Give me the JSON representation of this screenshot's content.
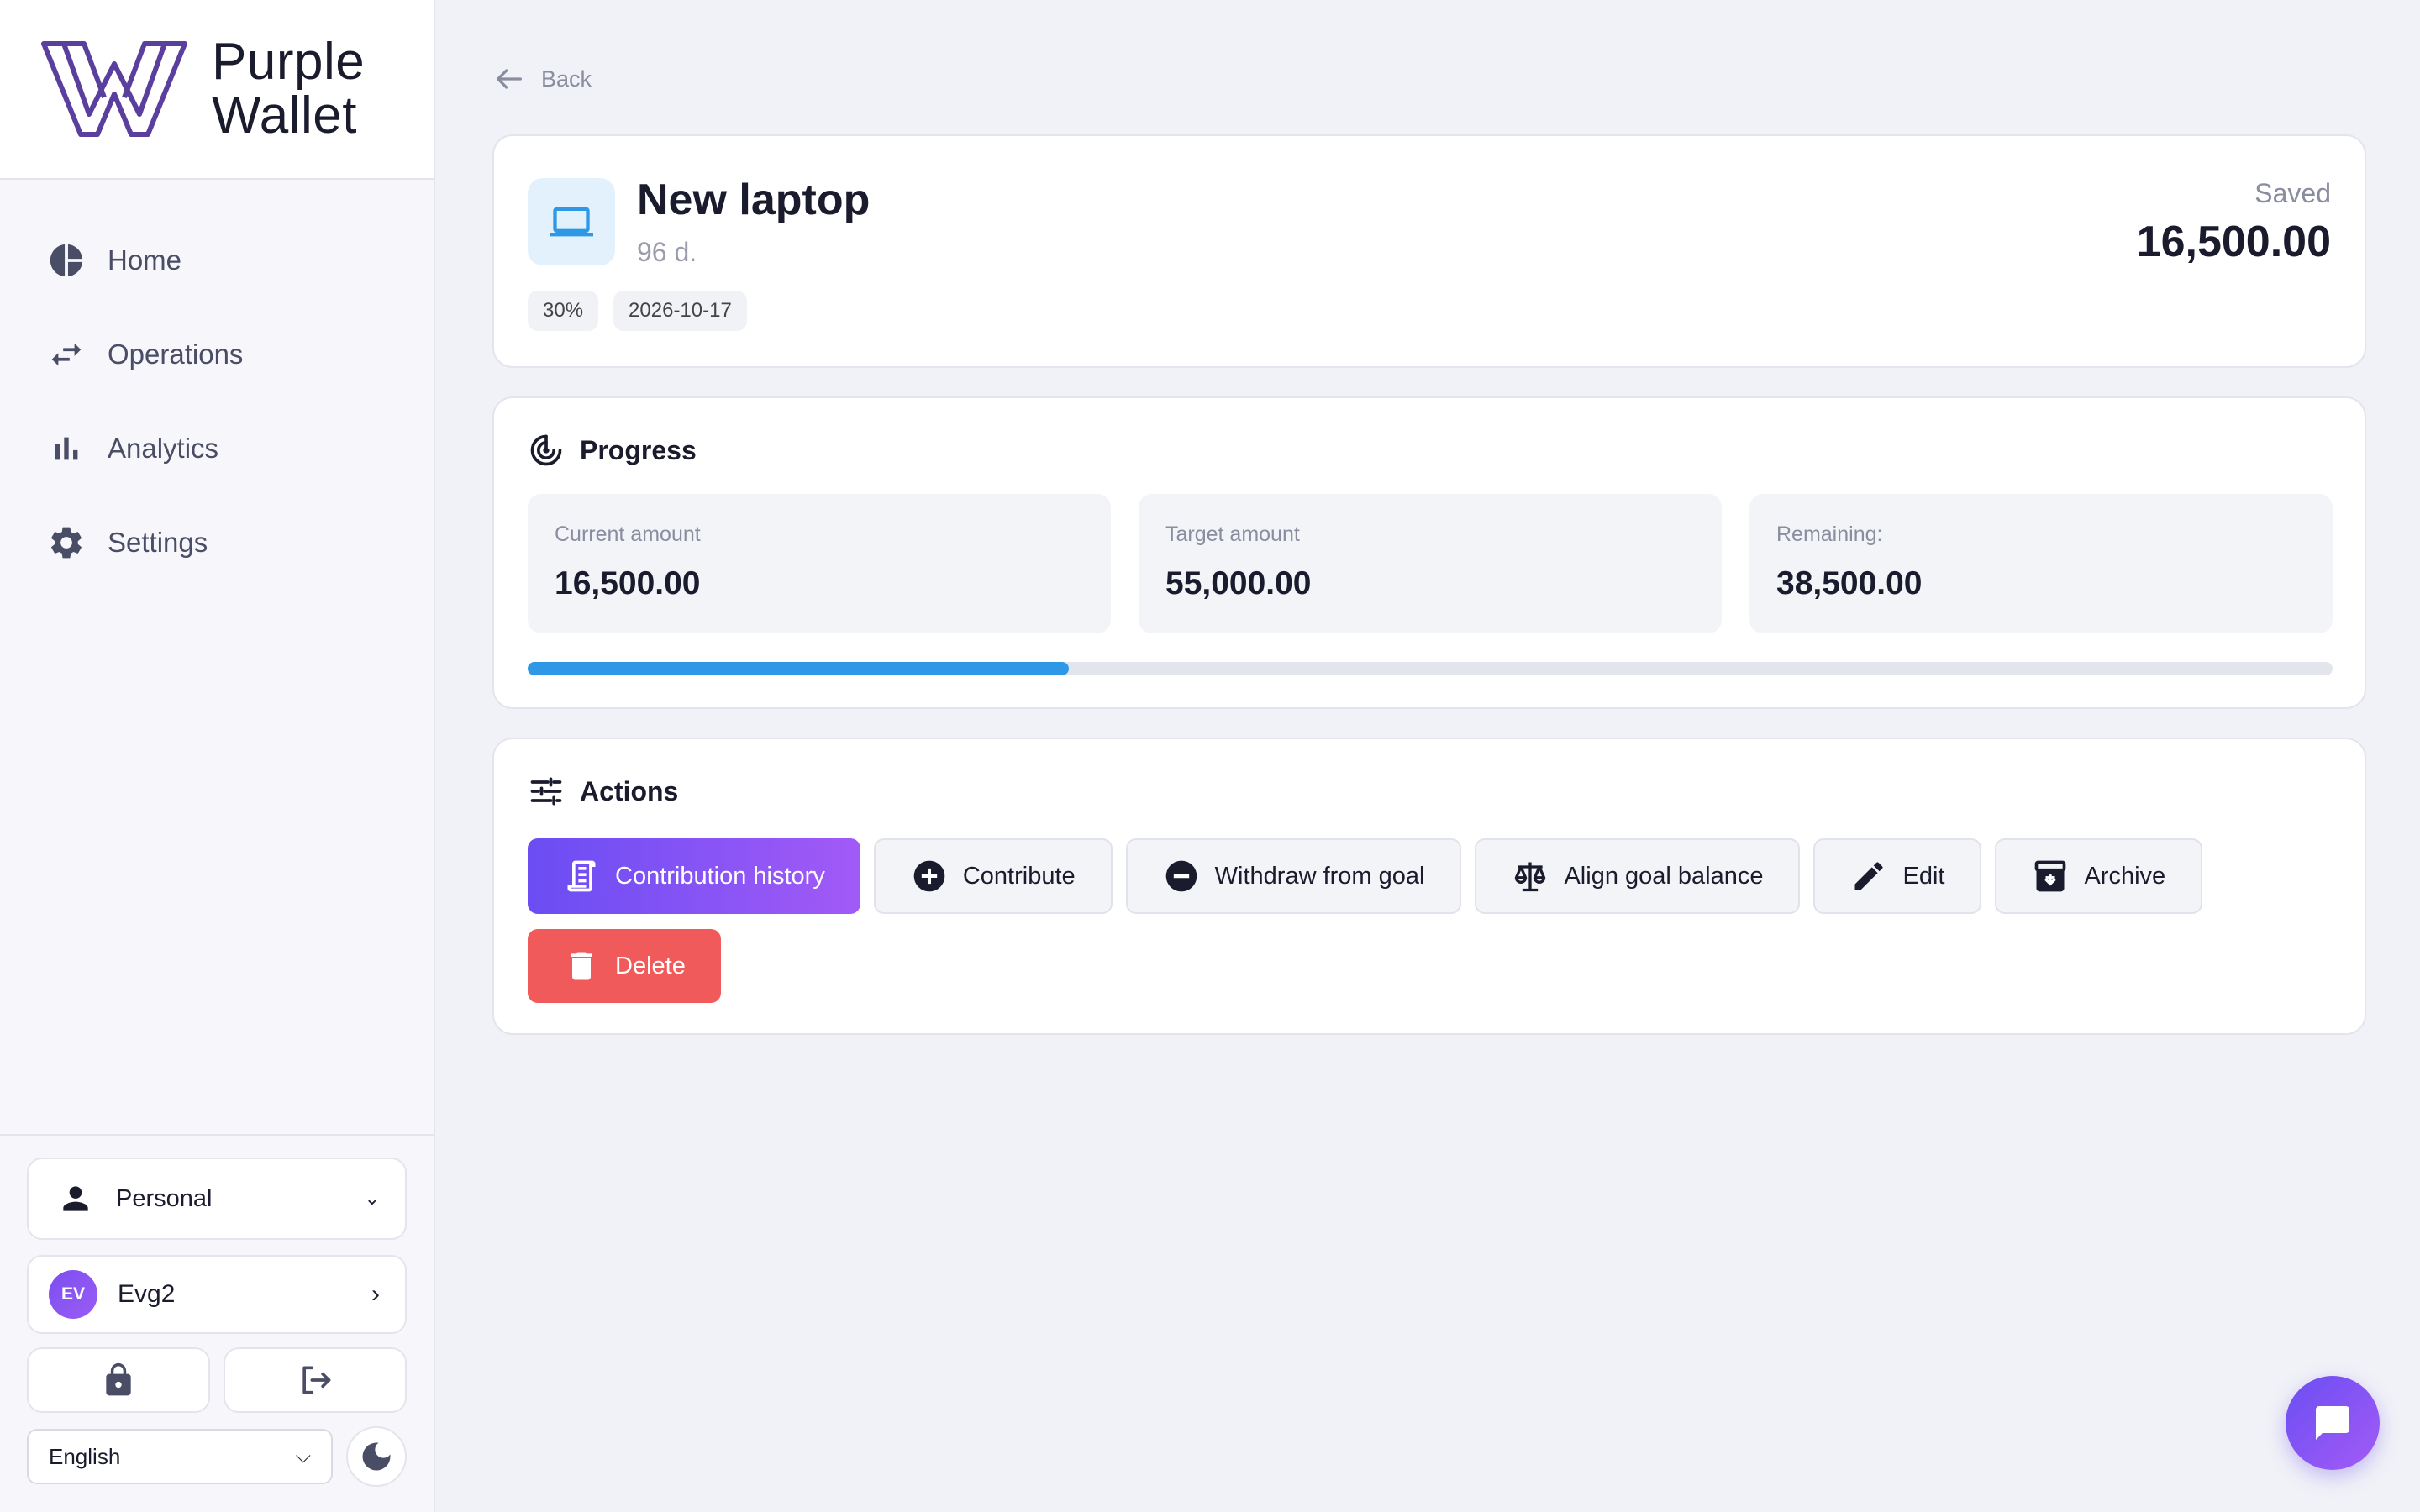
{
  "brand": {
    "line1": "Purple",
    "line2": "Wallet",
    "color": "#5b3f9e"
  },
  "nav": [
    {
      "label": "Home",
      "icon": "pie-chart-icon"
    },
    {
      "label": "Operations",
      "icon": "swap-arrows-icon"
    },
    {
      "label": "Analytics",
      "icon": "bar-chart-icon"
    },
    {
      "label": "Settings",
      "icon": "gear-icon"
    }
  ],
  "sidebar_bottom": {
    "workspace": "Personal",
    "user": {
      "initials": "EV",
      "name": "Evg2"
    },
    "language": "English"
  },
  "back_label": "Back",
  "goal": {
    "title": "New laptop",
    "days_left": "96 d.",
    "percent_tag": "30%",
    "date_tag": "2026-10-17",
    "saved_label": "Saved",
    "saved_value": "16,500.00"
  },
  "progress": {
    "title": "Progress",
    "stats": [
      {
        "label": "Current amount",
        "value": "16,500.00"
      },
      {
        "label": "Target amount",
        "value": "55,000.00"
      },
      {
        "label": "Remaining:",
        "value": "38,500.00"
      }
    ],
    "fraction": 0.3,
    "bar_color": "#2e98e6"
  },
  "actions": {
    "title": "Actions",
    "buttons": [
      {
        "label": "Contribution history",
        "icon": "receipt-icon"
      },
      {
        "label": "Contribute",
        "icon": "plus-circle-icon"
      },
      {
        "label": "Withdraw from goal",
        "icon": "minus-circle-icon"
      },
      {
        "label": "Align goal balance",
        "icon": "scale-icon"
      },
      {
        "label": "Edit",
        "icon": "pencil-icon"
      },
      {
        "label": "Archive",
        "icon": "archive-icon"
      }
    ],
    "delete_label": "Delete"
  },
  "colors": {
    "accent_start": "#6a4df3",
    "accent_end": "#a25af7",
    "danger": "#f05a5a"
  }
}
